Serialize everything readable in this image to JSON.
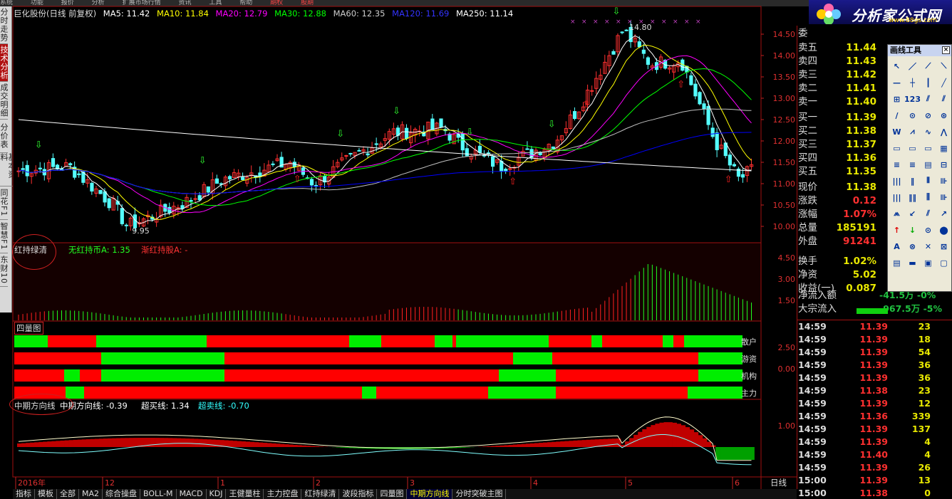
{
  "menu": [
    "系统",
    "功能",
    "报价",
    "分析",
    "扩展市场行情",
    "资讯",
    "工具",
    "帮助",
    "期权",
    "股期"
  ],
  "left_tabs": [
    "分时走势",
    "技术分析",
    "成交明细",
    "分价表",
    "基本资料",
    "同花F1",
    "智慧F1",
    "东财10"
  ],
  "left_tab_active": 1,
  "legend": {
    "stock": "巨化股份(日线 前复权)",
    "ma5": "MA5: 11.42",
    "ma10": "MA10: 11.84",
    "ma20": "MA20: 12.79",
    "ma30": "MA30: 12.88",
    "ma60": "MA60: 12.35",
    "ma120": "MA120: 11.69",
    "ma250": "MA250: 11.14"
  },
  "price_axis": [
    "14.50",
    "14.00",
    "13.50",
    "13.00",
    "12.50",
    "12.00",
    "11.50",
    "11.00",
    "10.50",
    "10.00"
  ],
  "annotations": {
    "high": "14.80",
    "low": "9.95"
  },
  "panel2": {
    "label": "红持绿清",
    "line1": "无红持币A: 1.35",
    "line2": "渐红持股A: -",
    "axis": [
      "4.50",
      "3.00",
      "1.50"
    ]
  },
  "panel3": {
    "label": "四量图",
    "rows": [
      "散户",
      "游资",
      "机构",
      "主力"
    ],
    "axis": [
      "2.50",
      "0.00"
    ]
  },
  "panel4": {
    "label": "中期方向线",
    "line1": "中期方向线: -0.39",
    "line2": "超买线: 1.34",
    "line3": "超卖线: -0.70",
    "axis": [
      "1.00"
    ]
  },
  "x_axis": [
    "2016年",
    "12",
    "1",
    "2",
    "3",
    "4",
    "5",
    "6"
  ],
  "period": "日线",
  "bottom_tabs": [
    "指标",
    "模板",
    "全部",
    "MA2",
    "综合操盘",
    "BOLL-M",
    "MACD",
    "KDJ",
    "王健量柱",
    "主力控盘",
    "红持绿清",
    "波段指标",
    "四量图",
    "中期方向线",
    "分时突破主图"
  ],
  "bottom_tab_active": 13,
  "order_book": {
    "ratio_label": "委",
    "asks": [
      {
        "label": "卖五",
        "price": "11.44"
      },
      {
        "label": "卖四",
        "price": "11.43"
      },
      {
        "label": "卖三",
        "price": "11.42"
      },
      {
        "label": "卖二",
        "price": "11.41"
      },
      {
        "label": "卖一",
        "price": "11.40"
      }
    ],
    "bids": [
      {
        "label": "买一",
        "price": "11.39"
      },
      {
        "label": "买二",
        "price": "11.38"
      },
      {
        "label": "买三",
        "price": "11.37"
      },
      {
        "label": "买四",
        "price": "11.36"
      },
      {
        "label": "买五",
        "price": "11.35"
      }
    ]
  },
  "stats": [
    {
      "label": "现价",
      "value": "11.38",
      "color": "#e8e800"
    },
    {
      "label": "涨跌",
      "value": "0.12",
      "color": "#ff3030"
    },
    {
      "label": "涨幅",
      "value": "1.07%",
      "color": "#ff3030"
    },
    {
      "label": "总量",
      "value": "185191",
      "color": "#e8e800"
    },
    {
      "label": "外盘",
      "value": "91241",
      "color": "#ff3030"
    },
    {
      "label": "换手",
      "value": "1.02%",
      "color": "#e8e800"
    },
    {
      "label": "净资",
      "value": "5.02",
      "color": "#e8e800"
    },
    {
      "label": "收益(一)",
      "value": "0.087",
      "color": "#e8e800"
    }
  ],
  "flows": [
    {
      "label": "净流入额",
      "value": "-41.5万",
      "pct": "-0%"
    },
    {
      "label": "大宗流入",
      "value": "-967.5万",
      "pct": "-5%"
    }
  ],
  "ticks": [
    {
      "t": "14:59",
      "p": "11.39",
      "v": "23",
      "c": "#ff3030"
    },
    {
      "t": "14:59",
      "p": "11.39",
      "v": "18",
      "c": "#ff3030"
    },
    {
      "t": "14:59",
      "p": "11.39",
      "v": "54",
      "c": "#ff3030"
    },
    {
      "t": "14:59",
      "p": "11.39",
      "v": "36",
      "c": "#ff3030"
    },
    {
      "t": "14:59",
      "p": "11.39",
      "v": "36",
      "c": "#ff3030"
    },
    {
      "t": "14:59",
      "p": "11.38",
      "v": "23",
      "c": "#ff3030"
    },
    {
      "t": "14:59",
      "p": "11.39",
      "v": "12",
      "c": "#ff3030"
    },
    {
      "t": "14:59",
      "p": "11.36",
      "v": "339",
      "c": "#ff3030"
    },
    {
      "t": "14:59",
      "p": "11.39",
      "v": "137",
      "c": "#ff3030"
    },
    {
      "t": "14:59",
      "p": "11.39",
      "v": "4",
      "c": "#ff3030"
    },
    {
      "t": "14:59",
      "p": "11.40",
      "v": "4",
      "c": "#ff3030"
    },
    {
      "t": "14:59",
      "p": "11.39",
      "v": "26",
      "c": "#ff3030"
    },
    {
      "t": "15:00",
      "p": "11.39",
      "v": "13",
      "c": "#ff3030"
    },
    {
      "t": "15:00",
      "p": "11.38",
      "v": "0",
      "c": "#ff3030"
    }
  ],
  "toolbox_title": "画线工具",
  "logo": {
    "title": "分析家公式网",
    "url": "www.88gs.com"
  },
  "colors": {
    "up": "#ff3030",
    "down": "#54ffff",
    "ma5": "#ffffff",
    "ma10": "#ffff00",
    "ma20": "#ff00ff",
    "ma30": "#00ff00",
    "ma60": "#c0c0c0",
    "ma120": "#0000ff",
    "ma250": "#ffffff"
  }
}
